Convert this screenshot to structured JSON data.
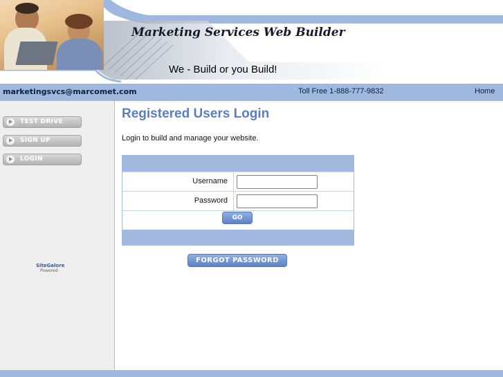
{
  "header": {
    "site_title": "Marketing Services Web Builder",
    "slogan": "We - Build or you Build!"
  },
  "infobar": {
    "email": "marketingsvcs@marcomet.com",
    "phone": "Toll Free 1-888-777-9832",
    "home_link": "Home"
  },
  "sidebar": {
    "items": [
      {
        "label": "TEST DRIVE"
      },
      {
        "label": "SIGN UP"
      },
      {
        "label": "LOGIN"
      }
    ],
    "powered": {
      "brand": "SiteGalore",
      "sub": "Powered"
    }
  },
  "main": {
    "heading": "Registered Users Login",
    "intro": "Login to build and manage your website.",
    "form": {
      "username_label": "Username",
      "username_value": "",
      "password_label": "Password",
      "password_value": "",
      "go_label": "GO"
    },
    "forgot_label": "FORGOT PASSWORD"
  },
  "colors": {
    "band_blue": "#9fb8e0",
    "heading_blue": "#5a7ec0",
    "button_blue": "#5c82c6",
    "sidebar_gray": "#efefef"
  }
}
